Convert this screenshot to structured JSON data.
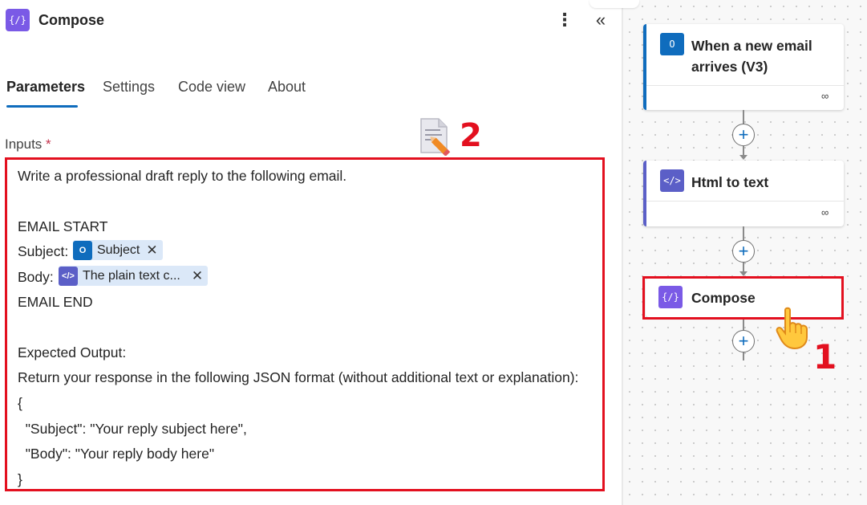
{
  "panel": {
    "title": "Compose",
    "icon": "compose-icon",
    "icon_glyph": "{∕}",
    "more_glyph": "⋮",
    "collapse_glyph": "«",
    "tabs": [
      {
        "label": "Parameters",
        "active": true
      },
      {
        "label": "Settings",
        "active": false
      },
      {
        "label": "Code view",
        "active": false
      },
      {
        "label": "About",
        "active": false
      }
    ],
    "inputs_label": "Inputs",
    "required_mark": "*"
  },
  "editor": {
    "lines": {
      "l1": "Write a professional draft reply to the following email.",
      "l2": "EMAIL START",
      "l3_prefix": "Subject:",
      "l4_prefix": "Body:",
      "l5": "EMAIL END",
      "l6": "Expected Output:",
      "l7": "Return your response in the following JSON format (without additional text or explanation):",
      "l8": "{",
      "l9": "  \"Subject\": \"Your reply subject here\",",
      "l10": "  \"Body\": \"Your reply body here\"",
      "l11": "}"
    },
    "tokens": {
      "subject": {
        "label": "Subject",
        "icon": "outlook-icon",
        "close": "✕"
      },
      "body": {
        "label": "The plain text c...",
        "icon": "html-to-text-icon",
        "close": "✕"
      }
    }
  },
  "annotations": {
    "step1": "1",
    "step2": "2"
  },
  "flow": {
    "cards": [
      {
        "title_line1": "When a new email",
        "title_line2": "arrives (V3)",
        "icon": "outlook-icon",
        "accent": "#0f6cbd"
      },
      {
        "title": "Html to text",
        "icon": "html-to-text-icon",
        "accent": "#5b5fc7"
      },
      {
        "title": "Compose",
        "icon": "compose-icon",
        "accent": "#7a5ae6"
      }
    ],
    "plus_glyph": "+",
    "link_glyph": "∞"
  },
  "colors": {
    "accent_blue": "#0f6cbd",
    "compose_purple": "#7a5ae6",
    "annotation_red": "#e3101f",
    "token_bg": "#dbe8f8"
  }
}
